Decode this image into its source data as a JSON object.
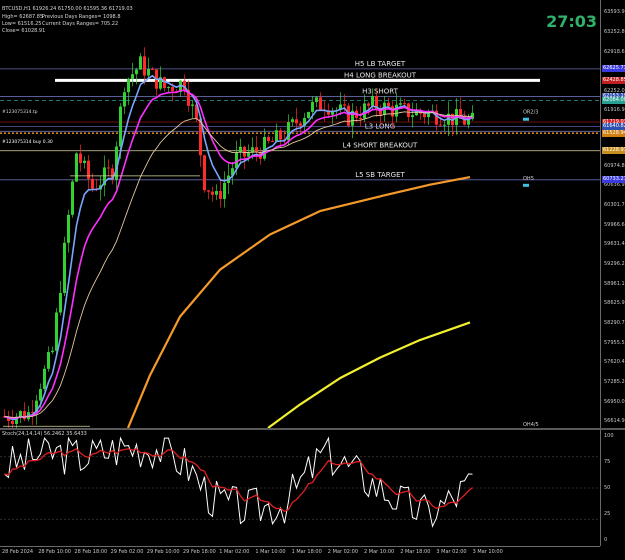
{
  "header": {
    "symbol_line": "BTCUSD,H1  61926.24 61750.00 61595.36 61719.03",
    "info": [
      {
        "left": "High= 62687.85",
        "right": "Previous Days Ranges= 1098.8"
      },
      {
        "left": "Low= 61516.25",
        "right": "Current Days Ranges= 705.22"
      },
      {
        "left": "Close= 61028.91",
        "right": ""
      }
    ],
    "timer": "27:03"
  },
  "indicators": {
    "main_label_1": "#123075314.tp",
    "main_label_2": "#123075314 buy 0.30",
    "osc_label": "Stoch(24,14,14) 56.2462 35.6433"
  },
  "levels": [
    {
      "name": "H5 LB TARGET",
      "price": 62625.73,
      "color": "#6a6ab0"
    },
    {
      "name": "H4 LONG BREAKOUT",
      "price": 62428.85,
      "color": "#ffffff"
    },
    {
      "name": "H3 SHORT",
      "price": 62153.19,
      "color": "#6a6ab0"
    },
    {
      "name": "L3 LONG",
      "price": 61560.0,
      "color": "#6a6ab0"
    },
    {
      "name": "L4 SHORT BREAKOUT",
      "price": 61228.97,
      "color": "#d8d8a0"
    },
    {
      "name": "L5 SB TARGET",
      "price": 60733.27,
      "color": "#6a6ab0"
    }
  ],
  "pivot_label": "Pivot",
  "markers": [
    {
      "label": "OR2/3",
      "price": 61860
    },
    {
      "label": "OH5",
      "price": 60733
    },
    {
      "label": "OH4/5",
      "price": 56530
    }
  ],
  "price_axis": [
    "63593.91",
    "63252.80",
    "62918.65",
    "62587.36",
    "62252.08",
    "61916.90",
    "61581.73",
    "61246.55",
    "60974.80",
    "60636.97",
    "60301.79",
    "59966.62",
    "59631.44",
    "59296.27",
    "58961.10",
    "58625.93",
    "58290.76",
    "57955.58",
    "57620.41",
    "57285.24",
    "56950.07",
    "56614.90"
  ],
  "price_tags": [
    {
      "text": "62625.73",
      "price": 62625.73,
      "color": "#3a3ae0"
    },
    {
      "text": "62428.85",
      "price": 62428.85,
      "color": "#c02020"
    },
    {
      "text": "62153.19",
      "price": 62153.19,
      "color": "#3050b0"
    },
    {
      "text": "62084.00",
      "price": 62084.0,
      "color": "#2aa090"
    },
    {
      "text": "61719.03",
      "price": 61719.03,
      "color": "#d02020"
    },
    {
      "text": "61640.82",
      "price": 61640.82,
      "color": "#3050b0"
    },
    {
      "text": "61528.94",
      "price": 61528.94,
      "color": "#d08010"
    },
    {
      "text": "61228.97",
      "price": 61228.97,
      "color": "#c89020"
    },
    {
      "text": "60733.27",
      "price": 60733.27,
      "color": "#3a3ae0"
    }
  ],
  "osc_axis": [
    "100",
    "75",
    "50",
    "25",
    "0"
  ],
  "time_axis": [
    "28 Feb 2024",
    "28 Feb 10:00",
    "28 Feb 18:00",
    "29 Feb 02:00",
    "29 Feb 10:00",
    "29 Feb 18:00",
    "1 Mar 02:00",
    "1 Mar 10:00",
    "1 Mar 18:00",
    "2 Mar 02:00",
    "2 Mar 10:00",
    "2 Mar 18:00",
    "3 Mar 02:00",
    "3 Mar 10:00"
  ],
  "colors": {
    "bull": "#34d134",
    "bear": "#ff2a2a",
    "ma_fast": "#7aa6ff",
    "ma_mid": "#ff30ff",
    "ma_slow": "#e0c8a0",
    "ma_orange": "#f59a2a",
    "ma_yellow": "#f0f030",
    "stoch_main": "#ffffff",
    "stoch_signal": "#e02020"
  }
}
